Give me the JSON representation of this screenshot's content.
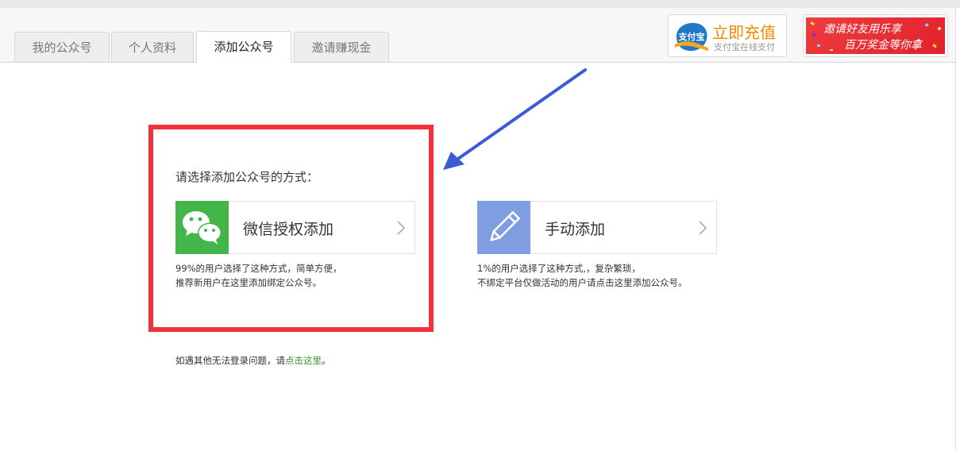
{
  "tabs": [
    {
      "label": "我的公众号",
      "active": false
    },
    {
      "label": "个人资料",
      "active": false
    },
    {
      "label": "添加公众号",
      "active": true
    },
    {
      "label": "邀请赚现金",
      "active": false
    }
  ],
  "recharge": {
    "logo_text": "支付宝",
    "title": "立即充值",
    "subtitle": "支付宝在线支付"
  },
  "invite_banner": {
    "line1": "邀请好友用乐享",
    "line2": "百万奖金等你拿"
  },
  "main": {
    "prompt": "请选择添加公众号的方式：",
    "options": [
      {
        "label": "微信授权添加",
        "icon": "wechat-icon",
        "icon_bg": "#44b549",
        "desc_line1": "99%的用户选择了这种方式，简单方便，",
        "desc_line2": "推荐新用户在这里添加绑定公众号。"
      },
      {
        "label": "手动添加",
        "icon": "pencil-icon",
        "icon_bg": "#7e9ee1",
        "desc_line1": "1%的用户选择了这种方式,，复杂繁琐，",
        "desc_line2": "不绑定平台仅做活动的用户请点击这里添加公众号。"
      }
    ],
    "help_prefix": "如遇其他无法登录问题，请",
    "help_link": "点击这里",
    "help_suffix": "。"
  },
  "colors": {
    "highlight_frame": "#f2323a",
    "annotation_arrow": "#3b5bd6",
    "recharge_accent": "#f08a00",
    "link": "#3a9a2b"
  }
}
